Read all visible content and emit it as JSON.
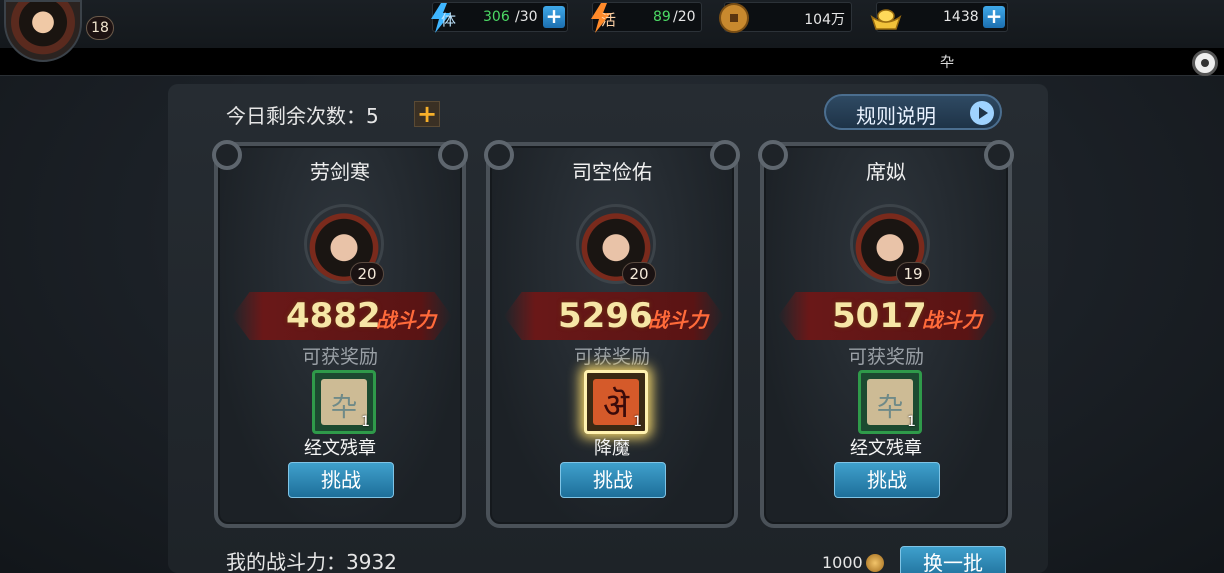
{
  "player": {
    "level": "18"
  },
  "resources": {
    "stamina": {
      "icon_char": "体",
      "value": "306",
      "max": "/30",
      "value_color": "#4cd964"
    },
    "vigor": {
      "icon_char": "活",
      "value": "89",
      "max": "/20",
      "value_color": "#4cd964"
    },
    "coins": {
      "value": "104万"
    },
    "ingots": {
      "value": "1438"
    }
  },
  "marquee": {
    "text": "卆"
  },
  "panel": {
    "remaining_label": "今日剩余次数：5",
    "rules_label": "规则说明",
    "reward_caption": "可获奖励",
    "power_label": "战斗力",
    "challenge_label": "挑战"
  },
  "opponents": [
    {
      "name": "劳剑寒",
      "level": "20",
      "power": "4882",
      "reward_name": "经文残章",
      "reward_qty": "1",
      "reward_glyph": "卆"
    },
    {
      "name": "司空俭佑",
      "level": "20",
      "power": "5296",
      "reward_name": "降魔",
      "reward_qty": "1",
      "reward_glyph": "ऄ"
    },
    {
      "name": "席姒",
      "level": "19",
      "power": "5017",
      "reward_name": "经文残章",
      "reward_qty": "1",
      "reward_glyph": "卆"
    }
  ],
  "bottom": {
    "my_power": "我的战斗力：3932",
    "refresh_cost": "1000",
    "refresh_label": "换一批"
  }
}
